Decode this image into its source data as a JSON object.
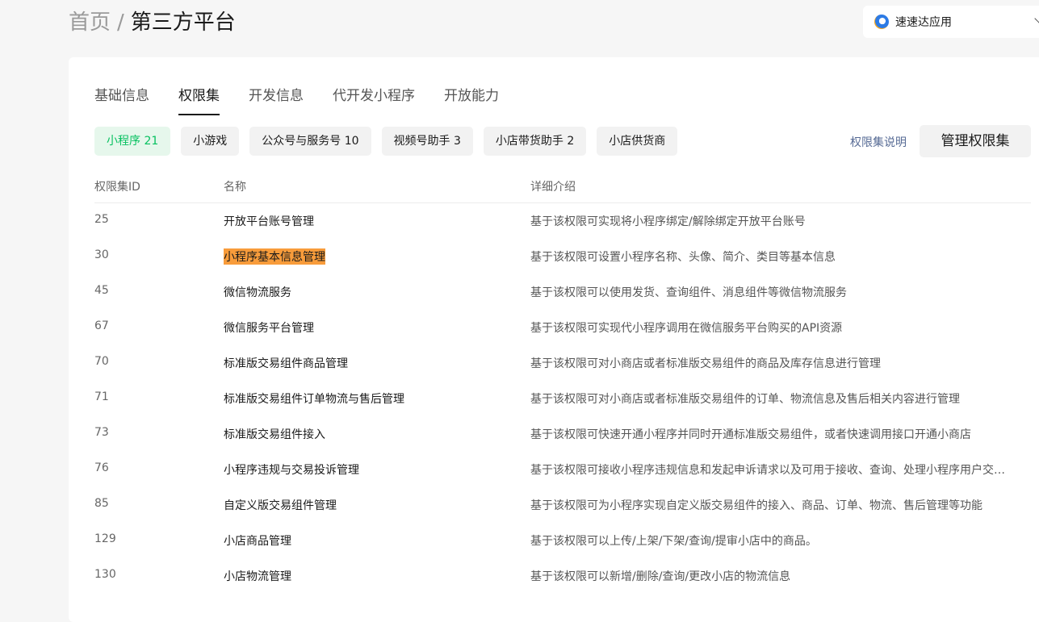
{
  "breadcrumb": {
    "home": "首页",
    "separator": "/",
    "current": "第三方平台"
  },
  "app_switch": {
    "name": "速速达应用"
  },
  "tabs": [
    {
      "label": "基础信息",
      "active": false
    },
    {
      "label": "权限集",
      "active": true
    },
    {
      "label": "开发信息",
      "active": false
    },
    {
      "label": "代开发小程序",
      "active": false
    },
    {
      "label": "开放能力",
      "active": false
    }
  ],
  "chips": [
    {
      "label": "小程序 21",
      "active": true
    },
    {
      "label": "小游戏",
      "active": false
    },
    {
      "label": "公众号与服务号 10",
      "active": false
    },
    {
      "label": "视频号助手 3",
      "active": false
    },
    {
      "label": "小店带货助手 2",
      "active": false
    },
    {
      "label": "小店供货商",
      "active": false
    }
  ],
  "actions": {
    "help": "权限集说明",
    "manage": "管理权限集"
  },
  "table": {
    "headers": {
      "id": "权限集ID",
      "name": "名称",
      "desc": "详细介绍"
    },
    "rows": [
      {
        "id": "25",
        "name": "开放平台账号管理",
        "desc": "基于该权限可实现将小程序绑定/解除绑定开放平台账号"
      },
      {
        "id": "30",
        "name": "小程序基本信息管理",
        "desc": "基于该权限可设置小程序名称、头像、简介、类目等基本信息",
        "highlight": true
      },
      {
        "id": "45",
        "name": "微信物流服务",
        "desc": "基于该权限可以使用发货、查询组件、消息组件等微信物流服务"
      },
      {
        "id": "67",
        "name": "微信服务平台管理",
        "desc": "基于该权限可实现代小程序调用在微信服务平台购买的API资源"
      },
      {
        "id": "70",
        "name": "标准版交易组件商品管理",
        "desc": "基于该权限可对小商店或者标准版交易组件的商品及库存信息进行管理"
      },
      {
        "id": "71",
        "name": "标准版交易组件订单物流与售后管理",
        "desc": "基于该权限可对小商店或者标准版交易组件的订单、物流信息及售后相关内容进行管理"
      },
      {
        "id": "73",
        "name": "标准版交易组件接入",
        "desc": "基于该权限可快速开通小程序并同时开通标准版交易组件，或者快速调用接口开通小商店"
      },
      {
        "id": "76",
        "name": "小程序违规与交易投诉管理",
        "desc": "基于该权限可接收小程序违规信息和发起申诉请求以及可用于接收、查询、处理小程序用户交…"
      },
      {
        "id": "85",
        "name": "自定义版交易组件管理",
        "desc": "基于该权限可为小程序实现自定义版交易组件的接入、商品、订单、物流、售后管理等功能"
      },
      {
        "id": "129",
        "name": "小店商品管理",
        "desc": "基于该权限可以上传/上架/下架/查询/提审小店中的商品。"
      },
      {
        "id": "130",
        "name": "小店物流管理",
        "desc": "基于该权限可以新增/删除/查询/更改小店的物流信息"
      }
    ]
  }
}
